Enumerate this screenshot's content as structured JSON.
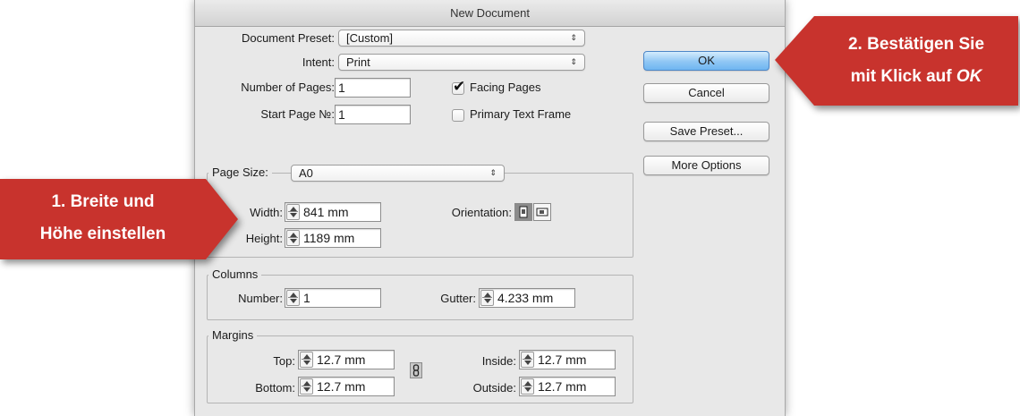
{
  "dialog": {
    "title": "New Document",
    "document_preset": {
      "label": "Document Preset:",
      "value": "[Custom]"
    },
    "intent": {
      "label": "Intent:",
      "value": "Print"
    },
    "number_of_pages": {
      "label": "Number of Pages:",
      "value": "1"
    },
    "start_page": {
      "label": "Start Page №:",
      "value": "1"
    },
    "facing_pages": {
      "label": "Facing Pages",
      "checked": true
    },
    "primary_text_frame": {
      "label": "Primary Text Frame",
      "checked": false
    },
    "page_size": {
      "label": "Page Size:",
      "value": "A0",
      "width": {
        "label": "Width:",
        "value": "841 mm"
      },
      "height": {
        "label": "Height:",
        "value": "1189 mm"
      },
      "orientation": {
        "label": "Orientation:",
        "selected": "portrait"
      }
    },
    "columns": {
      "legend": "Columns",
      "number": {
        "label": "Number:",
        "value": "1"
      },
      "gutter": {
        "label": "Gutter:",
        "value": "4.233 mm"
      }
    },
    "margins": {
      "legend": "Margins",
      "top": {
        "label": "Top:",
        "value": "12.7 mm"
      },
      "bottom": {
        "label": "Bottom:",
        "value": "12.7 mm"
      },
      "inside": {
        "label": "Inside:",
        "value": "12.7 mm"
      },
      "outside": {
        "label": "Outside:",
        "value": "12.7 mm"
      }
    },
    "buttons": {
      "ok": "OK",
      "cancel": "Cancel",
      "save_preset": "Save Preset...",
      "more_options": "More Options"
    }
  },
  "callouts": {
    "step1": {
      "line1": "1. Breite und",
      "line2": "Höhe einstellen"
    },
    "step2": {
      "line1": "2. Bestätigen Sie",
      "line2_prefix": "mit Klick auf ",
      "line2_emphasis": "OK"
    }
  },
  "colors": {
    "callout": "#c8332d",
    "ok_button": "#8fc6f4",
    "dialog_bg": "#e8e8e8"
  },
  "icons": [
    "popup-arrows-icon",
    "checkmark-icon",
    "stepper-icon",
    "portrait-icon",
    "landscape-icon",
    "chain-link-icon"
  ]
}
